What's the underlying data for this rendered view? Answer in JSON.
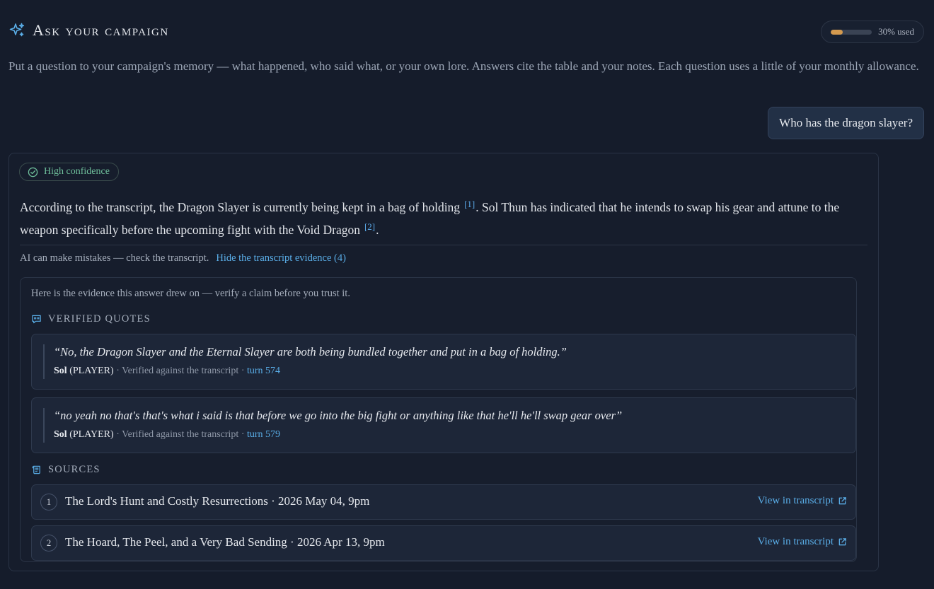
{
  "header": {
    "title": "Ask your campaign",
    "usage_label": "30% used",
    "usage_fraction": 0.3
  },
  "intro": "Put a question to your campaign's memory — what happened, who said what, or your own lore. Answers cite the table and your notes. Each question uses a little of your monthly allowance.",
  "user_question": "Who has the dragon slayer?",
  "answer": {
    "confidence": "High confidence",
    "text_part1": "According to the transcript, the Dragon Slayer is currently being kept in a bag of holding",
    "cite1": "[1]",
    "text_part2": ". Sol Thun has indicated that he intends to swap his gear and attune to the weapon specifically before the upcoming fight with the Void Dragon",
    "cite2": "[2]",
    "text_part3": ".",
    "disclaimer": "AI can make mistakes — check the transcript.",
    "evidence_toggle": "Hide the transcript evidence (4)"
  },
  "evidence": {
    "intro": "Here is the evidence this answer drew on — verify a claim before you trust it.",
    "quotes_heading": "VERIFIED QUOTES",
    "quotes": [
      {
        "text": "“No, the Dragon Slayer and the Eternal Slayer are both being bundled together and put in a bag of holding.”",
        "speaker": "Sol",
        "role": " (PLAYER)",
        "verified": " · Verified against the transcript · ",
        "turn": "turn 574"
      },
      {
        "text": "“no yeah no that's that's what i said is that before we go into the big fight or anything like that he'll he'll swap gear over”",
        "speaker": "Sol",
        "role": " (PLAYER)",
        "verified": " · Verified against the transcript · ",
        "turn": "turn 579"
      }
    ],
    "sources_heading": "SOURCES",
    "sources": [
      {
        "num": "1",
        "title": "The Lord's Hunt and Costly Resurrections · 2026 May 04, 9pm",
        "link": "View in transcript"
      },
      {
        "num": "2",
        "title": "The Hoard, The Peel, and a Very Bad Sending · 2026 Apr 13, 9pm",
        "link": "View in transcript"
      }
    ]
  },
  "colors": {
    "accent": "#5aaee8",
    "usage": "#d49a4f",
    "confidence": "#6fbf9b",
    "background": "#151c2b"
  }
}
